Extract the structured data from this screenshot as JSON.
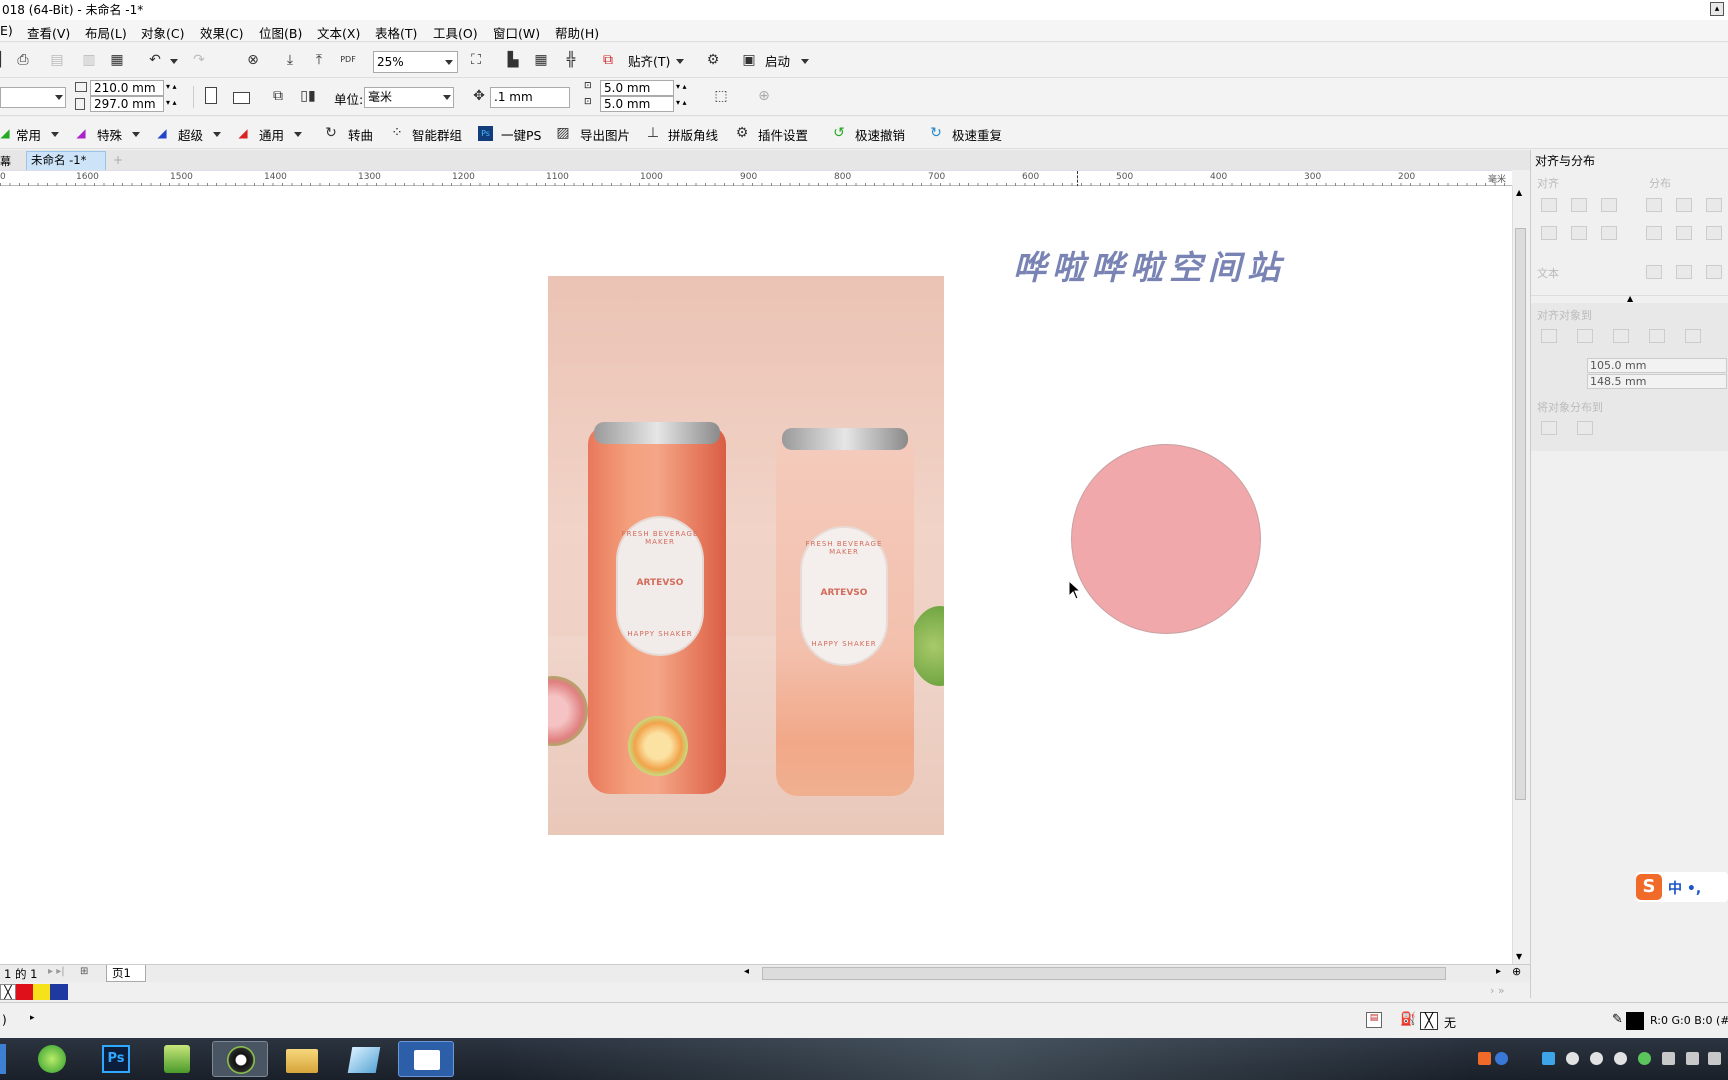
{
  "window": {
    "title": "018 (64-Bit) - 未命名 -1*"
  },
  "menu": [
    "E)",
    "查看(V)",
    "布局(L)",
    "对象(C)",
    "效果(C)",
    "位图(B)",
    "文本(X)",
    "表格(T)",
    "工具(O)",
    "窗口(W)",
    "帮助(H)"
  ],
  "toolbar": {
    "zoom": "25%",
    "snap_label": "贴齐(T)",
    "launch_label": "启动"
  },
  "property_bar": {
    "width": "210.0 mm",
    "height": "297.0 mm",
    "unit_label": "单位:",
    "unit_value": "毫米",
    "nudge": ".1 mm",
    "dup_x": "5.0 mm",
    "dup_y": "5.0 mm"
  },
  "plugin_bar": [
    "常用",
    "特殊",
    "超级",
    "通用",
    "转曲",
    "智能群组",
    "一键PS",
    "导出图片",
    "拼版角线",
    "插件设置",
    "极速撤销",
    "极速重复"
  ],
  "tabs": {
    "left_label": "幕",
    "doc_tab": "未命名 -1*"
  },
  "ruler": {
    "ticks": [
      "1600",
      "1500",
      "1400",
      "1300",
      "1200",
      "1100",
      "1000",
      "900",
      "800",
      "700",
      "600",
      "500",
      "400",
      "300",
      "200"
    ],
    "unit": "毫米"
  },
  "canvas": {
    "heading_text": "哗啦哗啦空间站",
    "heading_color": "#7a84b4",
    "circle_color": "#f0a8aa",
    "product_photo": {
      "can_text": [
        "FRESH BEVERAGE MAKER",
        "ARTEVSO",
        "HAPPY SHAKER"
      ]
    }
  },
  "right_panel": {
    "title": "对齐与分布",
    "align_label": "对齐",
    "distribute_label": "分布",
    "text_label": "文本",
    "align_to_label": "对齐对象到",
    "x_value": "105.0 mm",
    "y_value": "148.5 mm",
    "distribute_to_label": "将对象分布到"
  },
  "ime": {
    "text": "中 •,"
  },
  "page_nav": {
    "counter": "1 的 1",
    "page_tab": "页1"
  },
  "palette_colors": [
    "#e0101a",
    "#f7e11a",
    "#1e3aa0"
  ],
  "status": {
    "left": ")",
    "fill_label": "无",
    "color_info": "R:0 G:0 B:0 (#"
  },
  "taskbar_apps": [
    "360-browser",
    "photoshop",
    "coreldraw-tree",
    "coreldraw",
    "file-explorer",
    "notepad",
    "screen-recorder"
  ]
}
